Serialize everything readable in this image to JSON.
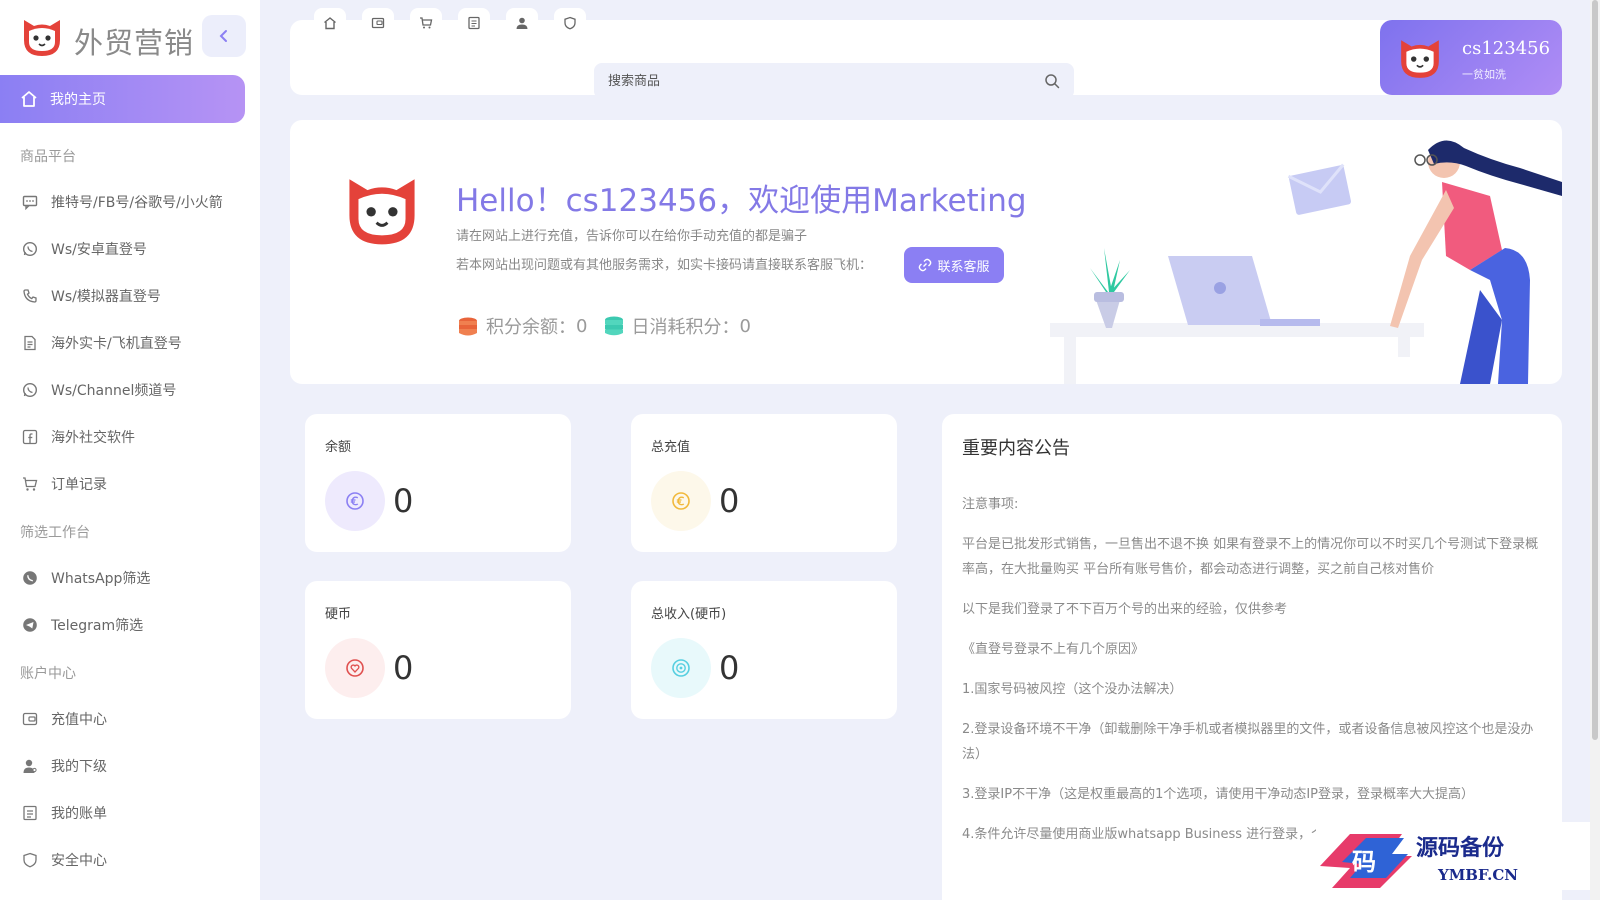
{
  "app": {
    "logo_text": "外贸营销"
  },
  "sidebar": {
    "active_item": "我的主页",
    "groups": [
      {
        "title": "商品平台"
      },
      {
        "title": "筛选工作台"
      },
      {
        "title": "账户中心"
      }
    ],
    "items": [
      {
        "label": "推特号/FB号/谷歌号/小火箭",
        "icon": "chat-icon"
      },
      {
        "label": "Ws/安卓直登号",
        "icon": "whatsapp-icon"
      },
      {
        "label": "Ws/模拟器直登号",
        "icon": "phone-icon"
      },
      {
        "label": "海外实卡/飞机直登号",
        "icon": "document-icon"
      },
      {
        "label": "Ws/Channel频道号",
        "icon": "whatsapp-icon"
      },
      {
        "label": "海外社交软件",
        "icon": "facebook-icon"
      },
      {
        "label": "订单记录",
        "icon": "cart-icon"
      },
      {
        "label": "WhatsApp筛选",
        "icon": "whatsapp-filled-icon"
      },
      {
        "label": "Telegram筛选",
        "icon": "telegram-icon"
      },
      {
        "label": "充值中心",
        "icon": "wallet-icon"
      },
      {
        "label": "我的下级",
        "icon": "user-icon"
      },
      {
        "label": "我的账单",
        "icon": "bill-icon"
      },
      {
        "label": "安全中心",
        "icon": "shield-icon"
      }
    ]
  },
  "topbar": {
    "search_placeholder": "搜索商品"
  },
  "user": {
    "name": "cs123456",
    "subtitle": "一贫如洗"
  },
  "hero": {
    "title": "Hello！cs123456，欢迎使用Marketing",
    "line1": "请在网站上进行充值，告诉你可以在给你手动充值的都是骗子",
    "line2": "若本网站出现问题或有其他服务需求，如实卡接码请直接联系客服飞机：",
    "contact_button": "联系客服",
    "points_balance_label": "积分余额：",
    "points_balance_value": "0",
    "daily_points_label": "日消耗积分：",
    "daily_points_value": "0"
  },
  "stats": {
    "balance": {
      "label": "余额",
      "value": "0"
    },
    "total_recharge": {
      "label": "总充值",
      "value": "0"
    },
    "coins": {
      "label": "硬币",
      "value": "0"
    },
    "total_income": {
      "label": "总收入(硬币)",
      "value": "0"
    }
  },
  "notice": {
    "title": "重要内容公告",
    "paragraphs": [
      "注意事项:",
      "平台是已批发形式销售，一旦售出不退不换 如果有登录不上的情况你可以不时买几个号测试下登录概率高，在大批量购买 平台所有账号售价，都会动态进行调整，买之前自己核对售价",
      "以下是我们登录了不下百万个号的出来的经验，仅供参考",
      "《直登号登录不上有几个原因》",
      "1.国家号码被风控（这个没办法解决）",
      "2.登录设备环境不干净（卸载删除干净手机或者模拟器里的文件，或者设备信息被风控这个也是没办法）",
      "3.登录IP不干净（这是权重最高的1个选项，请使用干净动态IP登录，登录概率大大提高）",
      "4.条件允许尽量使用商业版whatsapp Business 进行登录，个大概率就是IP不太好"
    ]
  },
  "watermark": {
    "cn": "源码备份",
    "en": "YMBF.CN",
    "glyph": "码"
  },
  "colors": {
    "accent": "#8b7ff3",
    "accent_light": "#b693f4",
    "background": "#eef0fa"
  }
}
